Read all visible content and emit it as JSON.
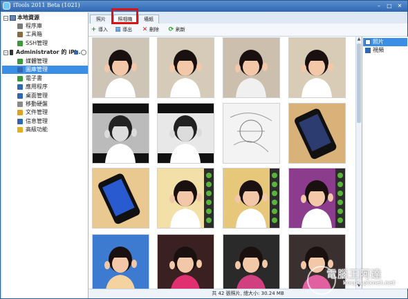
{
  "window": {
    "title": "iTools 2011 Beta (1021)",
    "controls": {
      "minimize": "–",
      "maximize": "□",
      "close": "✕"
    },
    "colors": {
      "titlebar": "#2f67b0",
      "selection": "#3a8ee6",
      "highlight_box": "#e31010"
    }
  },
  "sidebar": {
    "local_section": {
      "label": "本地資源",
      "icon": "computer-icon"
    },
    "local_items": [
      {
        "label": "程序庫",
        "icon": "grid-icon"
      },
      {
        "label": "工具箱",
        "icon": "tools-icon"
      },
      {
        "label": "SSH管理",
        "icon": "ssh-icon"
      }
    ],
    "device_section": {
      "label": "Administrator 的 iPh...",
      "icon": "iphone-icon"
    },
    "device_items": [
      {
        "label": "媒體管理",
        "icon": "media-icon"
      },
      {
        "label": "圖庫管理",
        "icon": "photo-library-icon",
        "selected": true
      },
      {
        "label": "電子書",
        "icon": "ebook-icon"
      },
      {
        "label": "應用程序",
        "icon": "apps-icon"
      },
      {
        "label": "桌面管理",
        "icon": "desktop-icon"
      },
      {
        "label": "移動硬盤",
        "icon": "disk-icon"
      },
      {
        "label": "文件管理",
        "icon": "folder-icon"
      },
      {
        "label": "信息管理",
        "icon": "message-icon"
      },
      {
        "label": "高級功能",
        "icon": "star-icon"
      }
    ]
  },
  "tabs": [
    {
      "label": "照片",
      "active": false
    },
    {
      "label": "照相機",
      "active": true
    },
    {
      "label": "墻紙",
      "active": false
    }
  ],
  "toolbar": [
    {
      "label": "導入",
      "icon": "import-icon",
      "color": "#2e9a2e",
      "glyph": "+"
    },
    {
      "label": "導出",
      "icon": "export-icon",
      "color": "#2e6fbf",
      "glyph": "▦"
    },
    {
      "label": "刪除",
      "icon": "delete-icon",
      "color": "#d02020",
      "glyph": "✕"
    },
    {
      "label": "刷新",
      "icon": "refresh-icon",
      "color": "#2e9a2e",
      "glyph": "⟳"
    }
  ],
  "right_panel": {
    "items": [
      {
        "label": "照片",
        "icon": "photo-icon",
        "selected": true
      },
      {
        "label": "視頻",
        "icon": "video-icon",
        "selected": false
      }
    ]
  },
  "gallery": {
    "thumbnails": [
      {
        "kind": "girl-color",
        "bg": "#cfc5b7",
        "shirt": "#ffffff"
      },
      {
        "kind": "girl-color",
        "bg": "#d6cbb9",
        "shirt": "#ffffff"
      },
      {
        "kind": "girl-color",
        "bg": "#cdbfae",
        "shirt": "#f0f0f0"
      },
      {
        "kind": "girl-color",
        "bg": "#d9ccb6",
        "shirt": "#ffffff"
      },
      {
        "kind": "girl-bw",
        "bg": "#bbbbbb",
        "shirt": "#ffffff"
      },
      {
        "kind": "girl-bw-comic",
        "bg": "#e8e8e8",
        "shirt": "#ffffff"
      },
      {
        "kind": "sketch",
        "bg": "#f3f3f3",
        "shirt": "#ffffff"
      },
      {
        "kind": "phone",
        "bg": "#d9b27a",
        "shirt": "#111111"
      },
      {
        "kind": "phone-blue",
        "bg": "#e9c990",
        "shirt": "#111111"
      },
      {
        "kind": "girl-frame",
        "bg": "#f2e0a8",
        "shirt": "#ffffff"
      },
      {
        "kind": "girl-frame",
        "bg": "#e7c77a",
        "shirt": "#ffffff"
      },
      {
        "kind": "girl-purple",
        "bg": "#8c3c8c",
        "shirt": "#ffffff"
      },
      {
        "kind": "girl-comic",
        "bg": "#3c7bd0",
        "shirt": "#f4d3a0"
      },
      {
        "kind": "girl-dark",
        "bg": "#3a2020",
        "shirt": "#e03070"
      },
      {
        "kind": "girl-dark",
        "bg": "#2a2a2a",
        "shirt": "#d04080"
      },
      {
        "kind": "girl-dark",
        "bg": "#3a3030",
        "shirt": "#e060a0"
      }
    ]
  },
  "status": "共 42 張照片, 總大小: 30.24 MB",
  "watermark": {
    "main": "電腦王阿達",
    "url": "kocpc.pixnet.net"
  }
}
